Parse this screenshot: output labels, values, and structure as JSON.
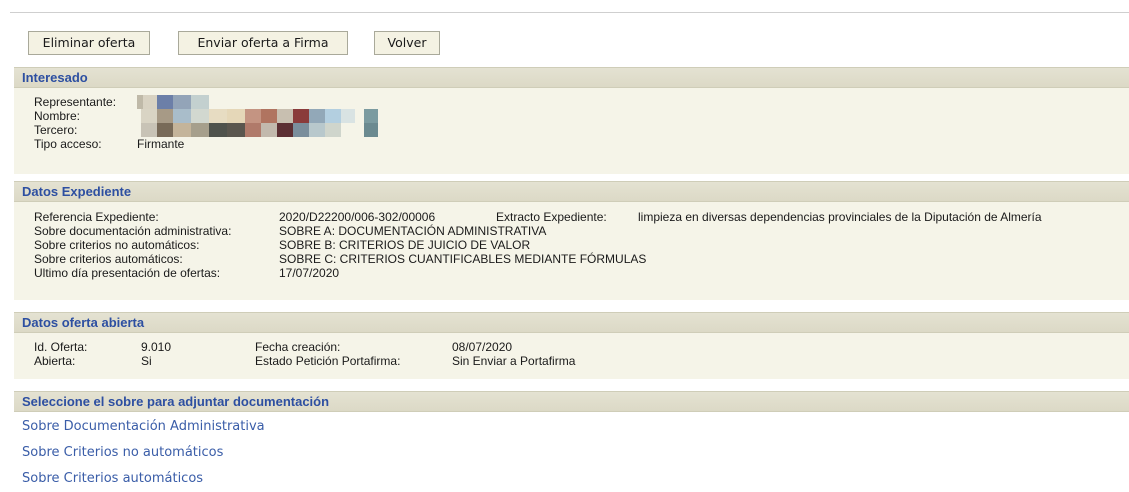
{
  "toolbar": {
    "delete_label": "Eliminar oferta",
    "send_label": "Enviar oferta a Firma",
    "back_label": "Volver"
  },
  "interesado": {
    "header": "Interesado",
    "representante_label": "Representante:",
    "nombre_label": "Nombre:",
    "tercero_label": "Tercero:",
    "tipo_acceso_label": "Tipo acceso:",
    "tipo_acceso_value": "Firmante"
  },
  "expediente": {
    "header": "Datos Expediente",
    "referencia_label": "Referencia Expediente:",
    "referencia_value": "2020/D22200/006-302/00006",
    "extracto_label": "Extracto Expediente:",
    "extracto_value": "limpieza en diversas dependencias provinciales de la Diputación de Almería",
    "sobre_doc_label": "Sobre documentación administrativa:",
    "sobre_doc_value": "SOBRE A: DOCUMENTACIÓN ADMINISTRATIVA",
    "sobre_no_auto_label": "Sobre criterios no automáticos:",
    "sobre_no_auto_value": "SOBRE B: CRITERIOS DE JUICIO DE VALOR",
    "sobre_auto_label": "Sobre criterios automáticos:",
    "sobre_auto_value": "SOBRE C: CRITERIOS CUANTIFICABLES MEDIANTE FÓRMULAS",
    "ultimo_dia_label": "Ultimo día presentación de ofertas:",
    "ultimo_dia_value": "17/07/2020"
  },
  "oferta": {
    "header": "Datos oferta abierta",
    "id_label": "Id. Oferta:",
    "id_value": "9.010",
    "fecha_label": "Fecha creación:",
    "fecha_value": "08/07/2020",
    "abierta_label": "Abierta:",
    "abierta_value": "Si",
    "estado_label": "Estado Petición Portafirma:",
    "estado_value": "Sin Enviar a Portafirma"
  },
  "sobres": {
    "header": "Seleccione el sobre para adjuntar documentación",
    "links": [
      "Sobre Documentación Administrativa",
      "Sobre Criterios no automáticos",
      "Sobre Criterios automáticos"
    ]
  },
  "colors": {
    "header_text": "#2d4fa1",
    "header_bg": "#dcd9c6",
    "body_bg": "#f5f4e8",
    "link": "#3a5da8"
  }
}
